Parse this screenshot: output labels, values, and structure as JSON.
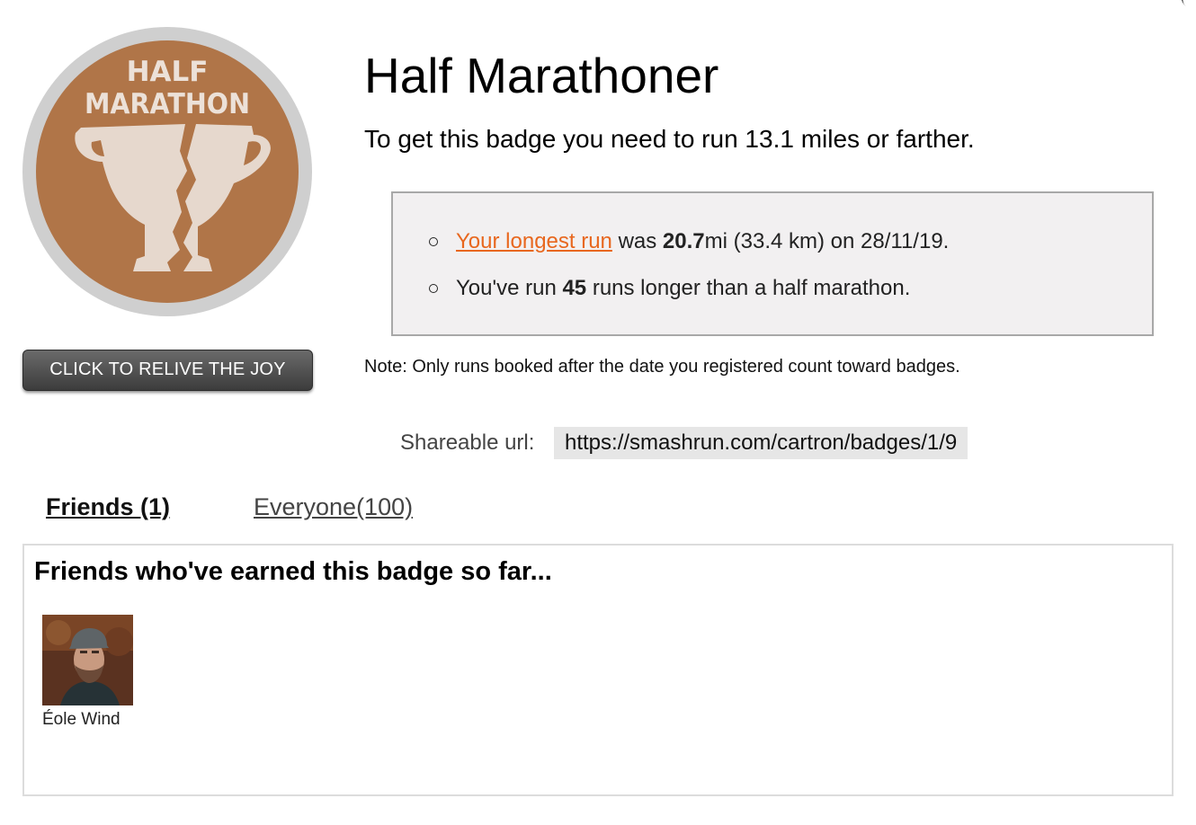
{
  "badge": {
    "art_text_line1": "HALF",
    "art_text_line2": "MARATHON",
    "title": "Half Marathoner",
    "description": "To get this badge you need to run 13.1 miles or farther."
  },
  "relive_button_label": "CLICK TO RELIVE THE JOY",
  "stats": {
    "line1_link": "Your longest run",
    "line1_was": " was ",
    "line1_value": "20.7",
    "line1_rest": "mi (33.4 km) on 28/11/19.",
    "line2_prefix": "You've run ",
    "line2_value": "45",
    "line2_rest": " runs longer than a half marathon."
  },
  "note": "Note: Only runs booked after the date you registered count toward badges.",
  "share": {
    "label": "Shareable url:",
    "url": "https://smashrun.com/cartron/badges/1/9"
  },
  "tabs": {
    "friends": "Friends (1)",
    "everyone": "Everyone(100)"
  },
  "friends_panel": {
    "heading": "Friends who've earned this badge so far...",
    "friends": [
      {
        "name": "Éole Wind"
      }
    ]
  },
  "colors": {
    "badge_brown": "#b07548",
    "badge_ring": "#cfcfcf",
    "link_orange": "#e8671e",
    "stats_bg": "#f2f0f1"
  },
  "icons": {
    "badge": "trophy-icon",
    "bullets": "hollow-circle-bullet-icon"
  }
}
